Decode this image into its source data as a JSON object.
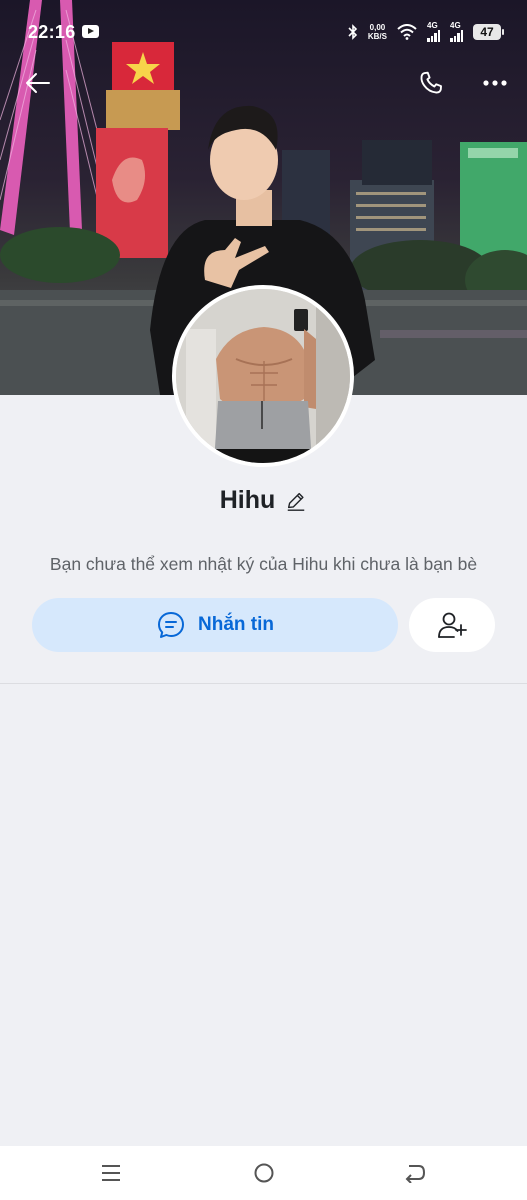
{
  "status_bar": {
    "time": "22:16",
    "net_speed_value": "0,00",
    "net_speed_unit": "KB/S",
    "network_1": "4G",
    "network_2": "4G",
    "battery": "47"
  },
  "header": {
    "back_icon": "arrow-left-icon",
    "call_icon": "phone-icon",
    "more_icon": "more-dots-icon"
  },
  "profile": {
    "name": "Hihu",
    "edit_icon": "pencil-icon",
    "notice": "Bạn chưa thể xem nhật ký của Hihu khi chưa là bạn bè"
  },
  "actions": {
    "message_label": "Nhắn tin",
    "message_icon": "chat-bubble-icon",
    "add_friend_icon": "add-user-icon",
    "accent_color": "#0868d7",
    "message_bg": "#d6e8fc"
  },
  "navigation": {
    "recents_icon": "menu-lines-icon",
    "home_icon": "circle-home-icon",
    "back_icon": "return-arrow-icon"
  }
}
